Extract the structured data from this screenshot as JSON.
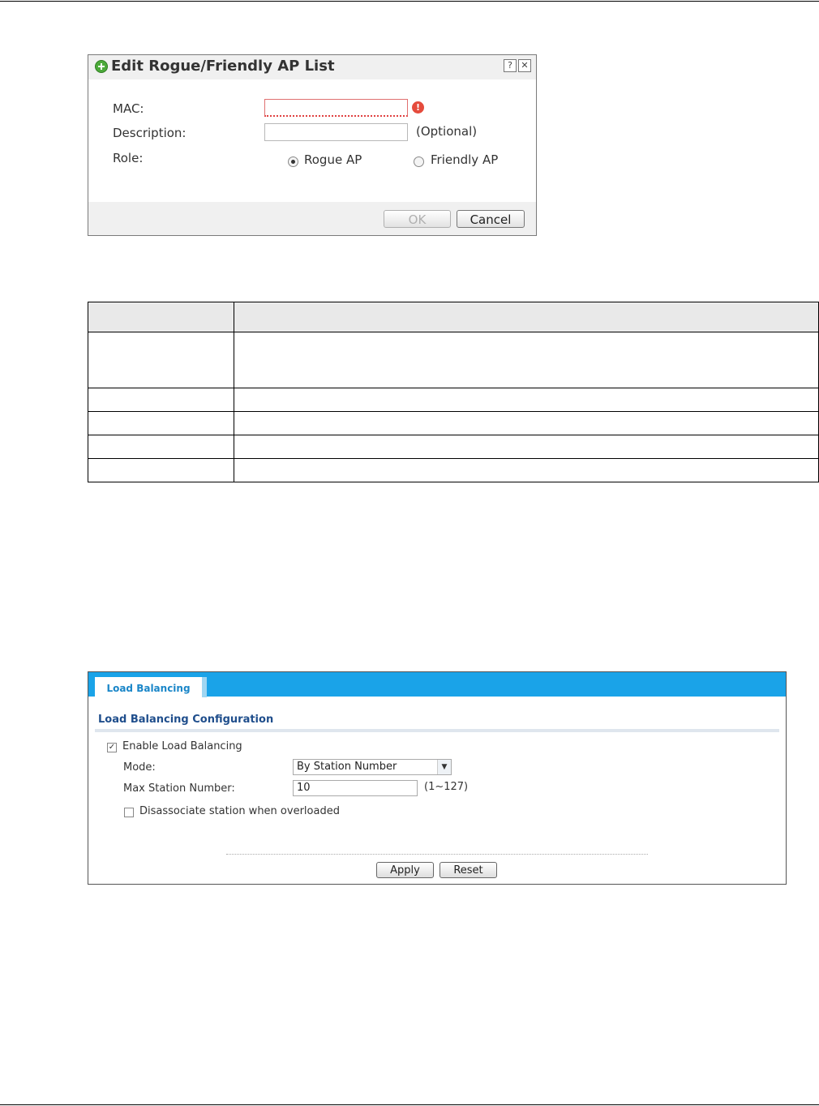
{
  "dialog": {
    "title": "Edit Rogue/Friendly AP List",
    "help_icon": "?",
    "close_icon": "✕",
    "mac_label": "MAC:",
    "mac_value": "",
    "description_label": "Description:",
    "description_value": "",
    "optional_note": "(Optional)",
    "role_label": "Role:",
    "role_options": [
      "Rogue AP",
      "Friendly AP"
    ],
    "role_selected": "Rogue AP",
    "ok_label": "OK",
    "cancel_label": "Cancel",
    "error_icon": "!"
  },
  "table": {
    "headers": [
      "",
      ""
    ],
    "rows": [
      [
        "",
        ""
      ],
      [
        "",
        ""
      ],
      [
        "",
        ""
      ],
      [
        "",
        ""
      ],
      [
        "",
        ""
      ]
    ]
  },
  "load_balancing": {
    "tab_label": "Load Balancing",
    "section_title": "Load Balancing Configuration",
    "enable_label": "Enable Load Balancing",
    "enable_checked": true,
    "mode_label": "Mode:",
    "mode_value": "By Station Number",
    "max_station_label": "Max Station Number:",
    "max_station_value": "10",
    "max_station_range": "(1~127)",
    "disassociate_label": "Disassociate station when overloaded",
    "disassociate_checked": false,
    "apply_label": "Apply",
    "reset_label": "Reset"
  }
}
